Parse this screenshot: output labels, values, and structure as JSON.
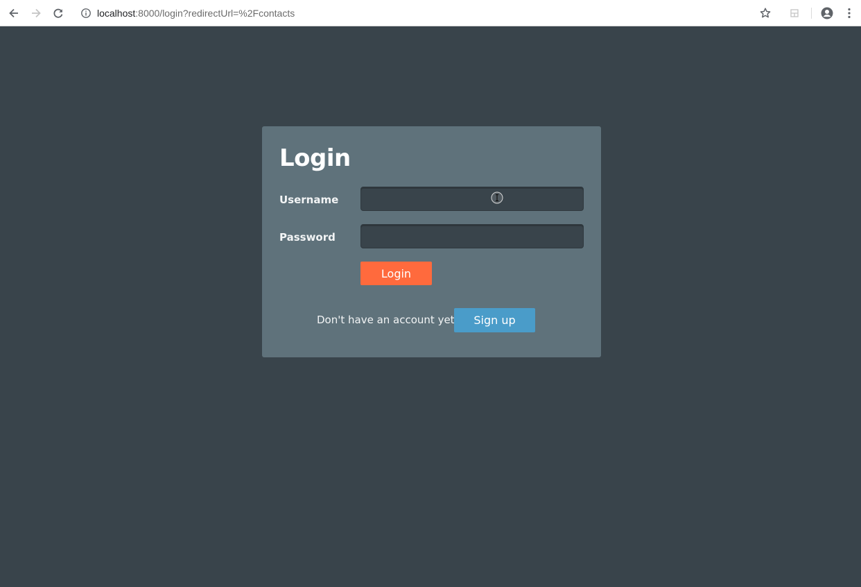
{
  "browser": {
    "url_host": "localhost",
    "url_path": ":8000/login?redirectUrl=%2Fcontacts",
    "icons": {
      "back": "arrow-left-icon",
      "forward": "arrow-right-icon",
      "reload": "reload-icon",
      "info": "info-icon",
      "bookmark": "star-icon",
      "extension": "extension-icon",
      "profile": "account-icon",
      "menu": "kebab-menu-icon"
    }
  },
  "login": {
    "title": "Login",
    "username_label": "Username",
    "username_value": "",
    "password_label": "Password",
    "password_value": "",
    "submit_label": "Login",
    "no_account_text": "Don't have an account yet?",
    "signup_label": "Sign up"
  },
  "colors": {
    "page_background": "#39444b",
    "card_background": "#5f727b",
    "login_button": "#ff6a3d",
    "signup_button": "#4a9cc9"
  }
}
